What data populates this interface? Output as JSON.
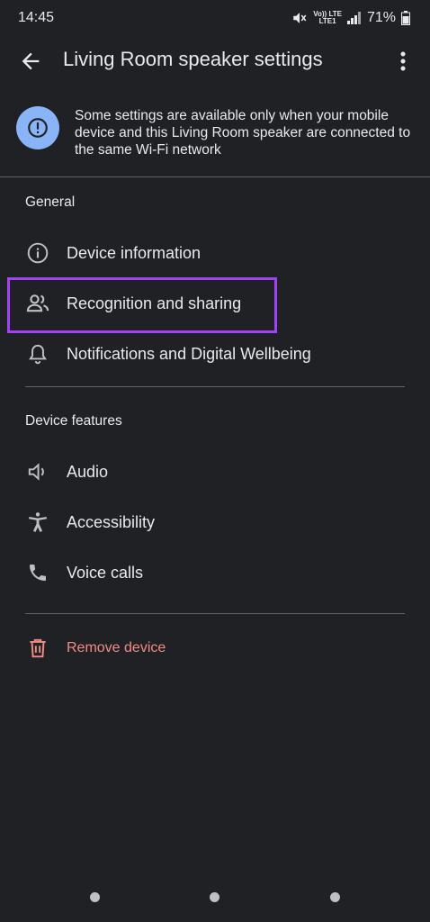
{
  "status_bar": {
    "time": "14:45",
    "network_top": "Vo)) LTE",
    "network_bottom": "LTE1",
    "battery": "71%"
  },
  "app_bar": {
    "title": "Living Room speaker settings",
    "back_icon": "arrow-back-icon",
    "more_icon": "more-vert-icon"
  },
  "banner": {
    "icon": "info-alert-icon",
    "text": "Some settings are available only when your mobile device and this Living Room speaker are connected to the same Wi-Fi network"
  },
  "sections": {
    "general": {
      "header": "General",
      "items": [
        {
          "label": "Device information",
          "icon": "info-icon"
        },
        {
          "label": "Recognition and sharing",
          "icon": "people-icon"
        },
        {
          "label": "Notifications and Digital Wellbeing",
          "icon": "bell-icon"
        }
      ]
    },
    "device_features": {
      "header": "Device features",
      "items": [
        {
          "label": "Audio",
          "icon": "speaker-icon"
        },
        {
          "label": "Accessibility",
          "icon": "accessibility-icon"
        },
        {
          "label": "Voice calls",
          "icon": "phone-icon"
        }
      ]
    },
    "remove": {
      "label": "Remove device",
      "icon": "trash-icon",
      "color": "#f28b82"
    }
  },
  "highlight": {
    "color": "#a142f4",
    "target": "Recognition and sharing"
  },
  "colors": {
    "background": "#202124",
    "accent": "#8ab4f8",
    "text": "#e8eaed"
  }
}
